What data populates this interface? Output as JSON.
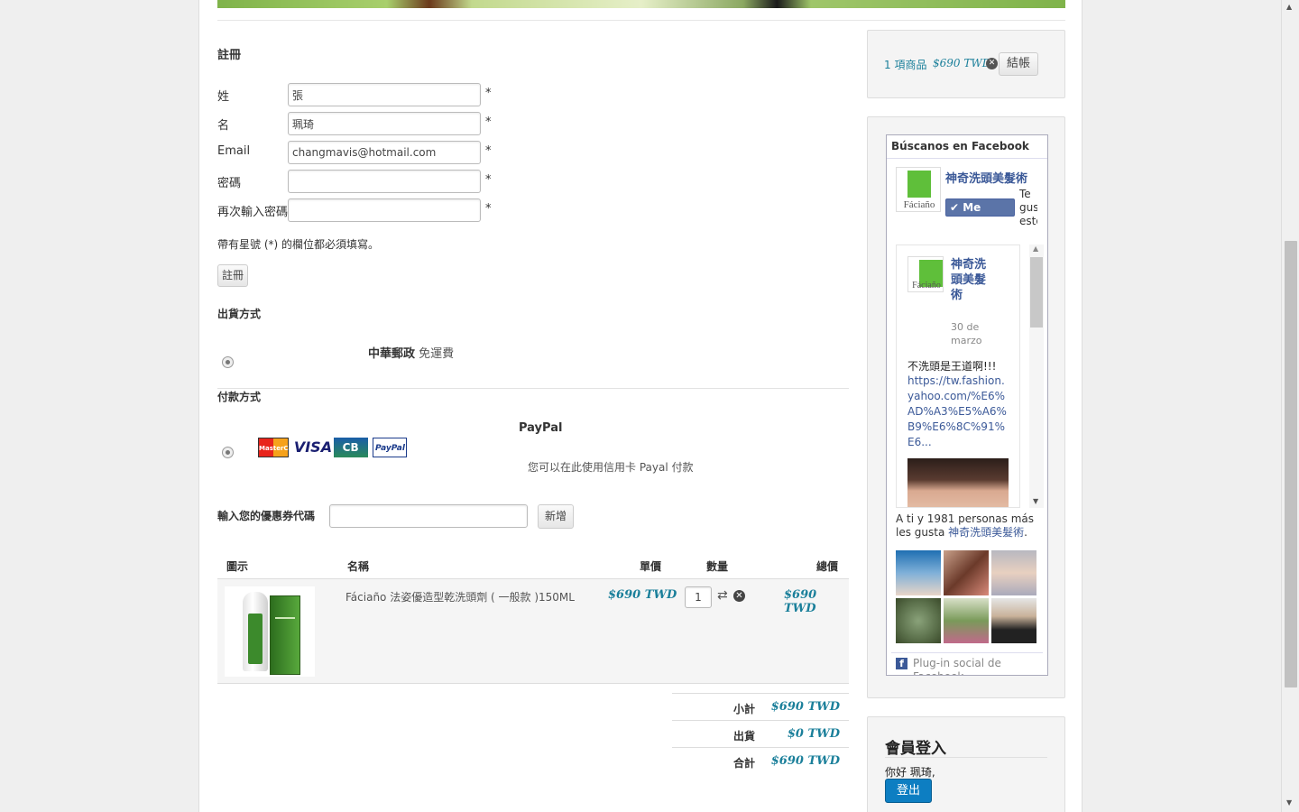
{
  "register": {
    "title": "註冊",
    "fields": [
      {
        "label": "姓",
        "value": "張"
      },
      {
        "label": "名",
        "value": "珮琦"
      },
      {
        "label": "Email",
        "value": "changmavis@hotmail.com"
      },
      {
        "label": "密碼",
        "value": ""
      },
      {
        "label": "再次輸入密碼",
        "value": ""
      }
    ],
    "required_mark": "*",
    "note": "帶有星號 (*) 的欄位都必須填寫。",
    "button": "註冊"
  },
  "shipping": {
    "title": "出貨方式",
    "option_name": "中華郵政",
    "option_fee": "免運費"
  },
  "payment": {
    "title": "付款方式",
    "option_name": "PayPal",
    "option_desc": "您可以在此使用信用卡 Payal 付款",
    "card_logos": [
      "MasterCard",
      "VISA",
      "CB",
      "PayPal"
    ]
  },
  "coupon": {
    "label": "輸入您的優惠券代碼",
    "value": "",
    "button": "新增"
  },
  "cart_table": {
    "headers": {
      "image": "圖示",
      "name": "名稱",
      "unit_price": "單價",
      "qty": "數量",
      "total": "總價"
    },
    "rows": [
      {
        "name": "Fáciaño 法姿優造型乾洗頭劑 ( 一般款 )150ML",
        "unit_price": "$690 TWD",
        "qty": "1",
        "total": "$690 TWD"
      }
    ],
    "summary": [
      {
        "label": "小計",
        "value": "$690 TWD"
      },
      {
        "label": "出貨",
        "value": "$0 TWD"
      },
      {
        "label": "合計",
        "value": "$690 TWD"
      }
    ]
  },
  "minicart": {
    "summary": "1 項商品",
    "price": "$690 TWD",
    "checkout_button": "結帳"
  },
  "facebook": {
    "title": "Búscanos en Facebook",
    "page_name": "神奇洗頭美髮術",
    "like_button": "Me gusta",
    "like_side_text": "Te gus esto",
    "logo_text": "Fáciaño",
    "post": {
      "page_name": "神奇洗頭美髮術",
      "date": "30 de marzo",
      "text": "不洗頭是王道啊!!!",
      "link": "https://tw.fashion.yahoo.com/%E6%AD%A3%E5%A6%B9%E6%8C%91%E6..."
    },
    "friends_text_pre": "A ti y 1981 personas más les gusta ",
    "friends_text_link": "神奇洗頭美髮術",
    "friends_text_post": ".",
    "plugin_text": "Plug-in social de Facebook"
  },
  "login": {
    "title": "會員登入",
    "greeting": "你好 珮琦,",
    "logout_button": "登出"
  },
  "colors": {
    "link": "#1a7f9a",
    "price": "#1a7f9a",
    "fb_blue": "#3b5998",
    "logout_bg": "#0d7ec2",
    "logo_green": "#5fbf3a"
  }
}
